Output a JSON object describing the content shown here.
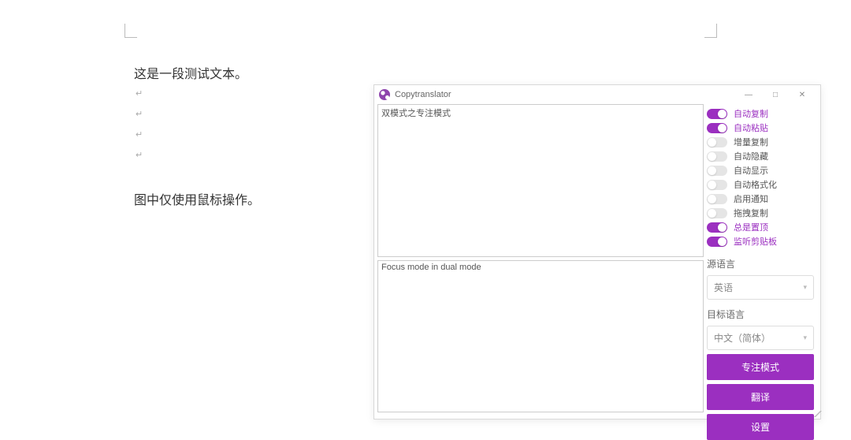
{
  "document": {
    "line1": "这是一段测试文本。",
    "paragraph_mark": "↵",
    "line2": "图中仅使用鼠标操作。"
  },
  "app": {
    "title": "Copytranslator",
    "window_controls": {
      "minimize": "—",
      "maximize": "□",
      "close": "✕"
    },
    "source_text": "双模式之专注模式",
    "translated_text": "Focus mode in dual mode",
    "toggles": [
      {
        "label": "自动复制",
        "on": true
      },
      {
        "label": "自动粘贴",
        "on": true
      },
      {
        "label": "增量复制",
        "on": false
      },
      {
        "label": "自动隐藏",
        "on": false
      },
      {
        "label": "自动显示",
        "on": false
      },
      {
        "label": "自动格式化",
        "on": false
      },
      {
        "label": "启用通知",
        "on": false
      },
      {
        "label": "拖拽复制",
        "on": false
      },
      {
        "label": "总是置顶",
        "on": true
      },
      {
        "label": "监听剪贴板",
        "on": true
      }
    ],
    "source_lang_label": "源语言",
    "source_lang_value": "英语",
    "target_lang_label": "目标语言",
    "target_lang_value": "中文（简体）",
    "buttons": {
      "focus": "专注模式",
      "translate": "翻译",
      "settings": "设置"
    }
  }
}
